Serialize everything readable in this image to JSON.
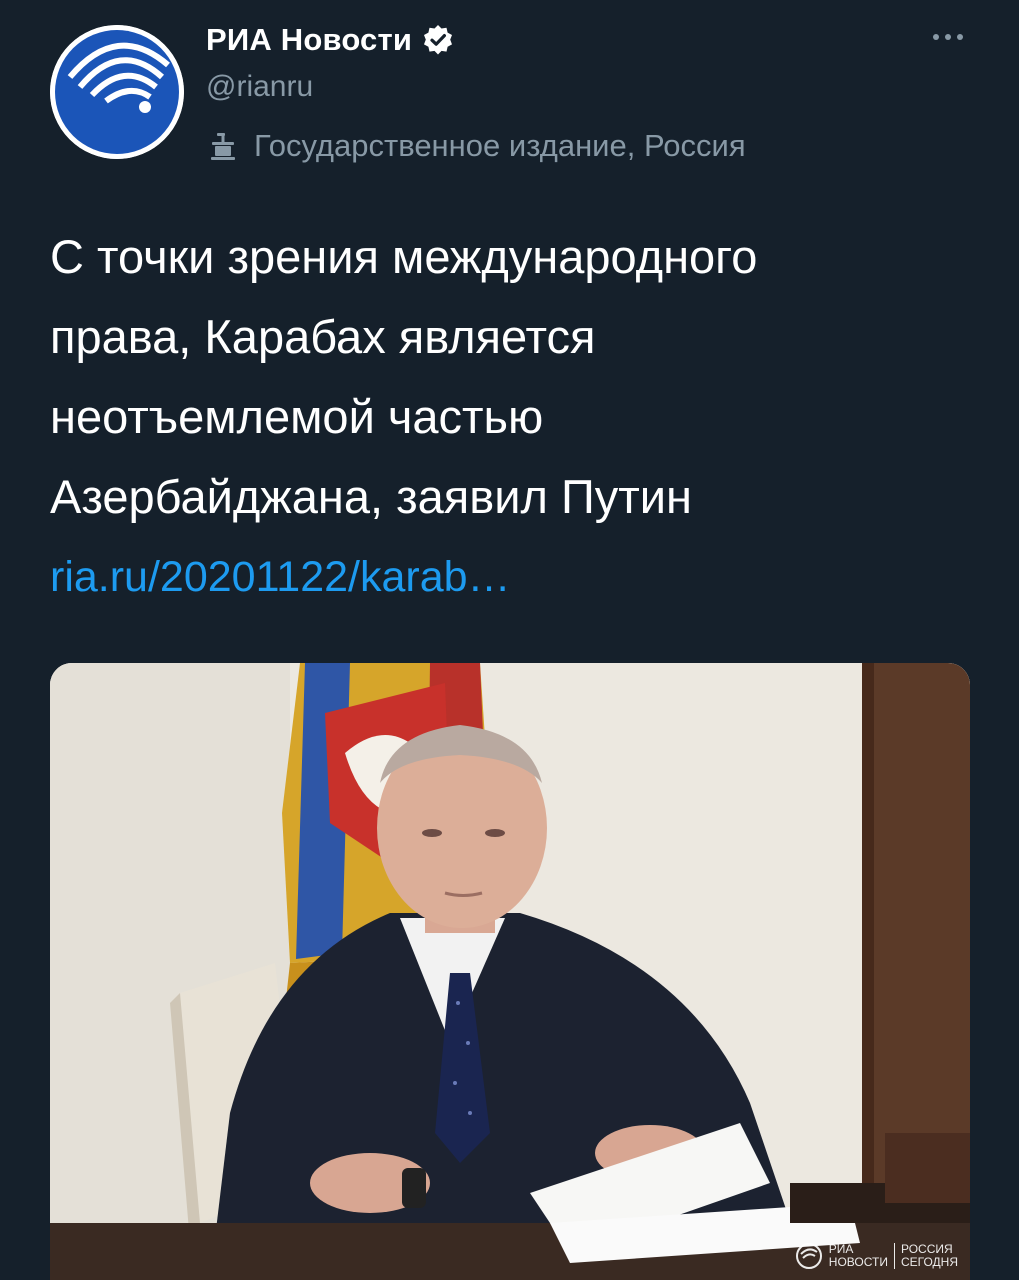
{
  "account": {
    "display_name": "РИА Новости",
    "handle": "@rianru",
    "verified": true,
    "label": "Государственное издание, Россия",
    "avatar_icon": "ria-globe-logo-icon",
    "label_icon": "government-podium-icon"
  },
  "menu": {
    "icon": "more-options-icon"
  },
  "tweet": {
    "text_lines": [
      "С точки зрения международного",
      "права, Карабах является",
      "неотъемлемой частью",
      "Азербайджана, заявил Путин"
    ],
    "link": "ria.ru/20201122/karab…"
  },
  "media": {
    "watermark": {
      "left_line1": "РИА",
      "left_line2": "НОВОСТИ",
      "right_line1": "РОССИЯ",
      "right_line2": "СЕГОДНЯ"
    }
  },
  "colors": {
    "background": "#15202b",
    "text": "#ffffff",
    "secondary": "#8899a6",
    "link": "#1d9bf0",
    "verified": "#ffffff",
    "brand_blue": "#1b55b8"
  }
}
